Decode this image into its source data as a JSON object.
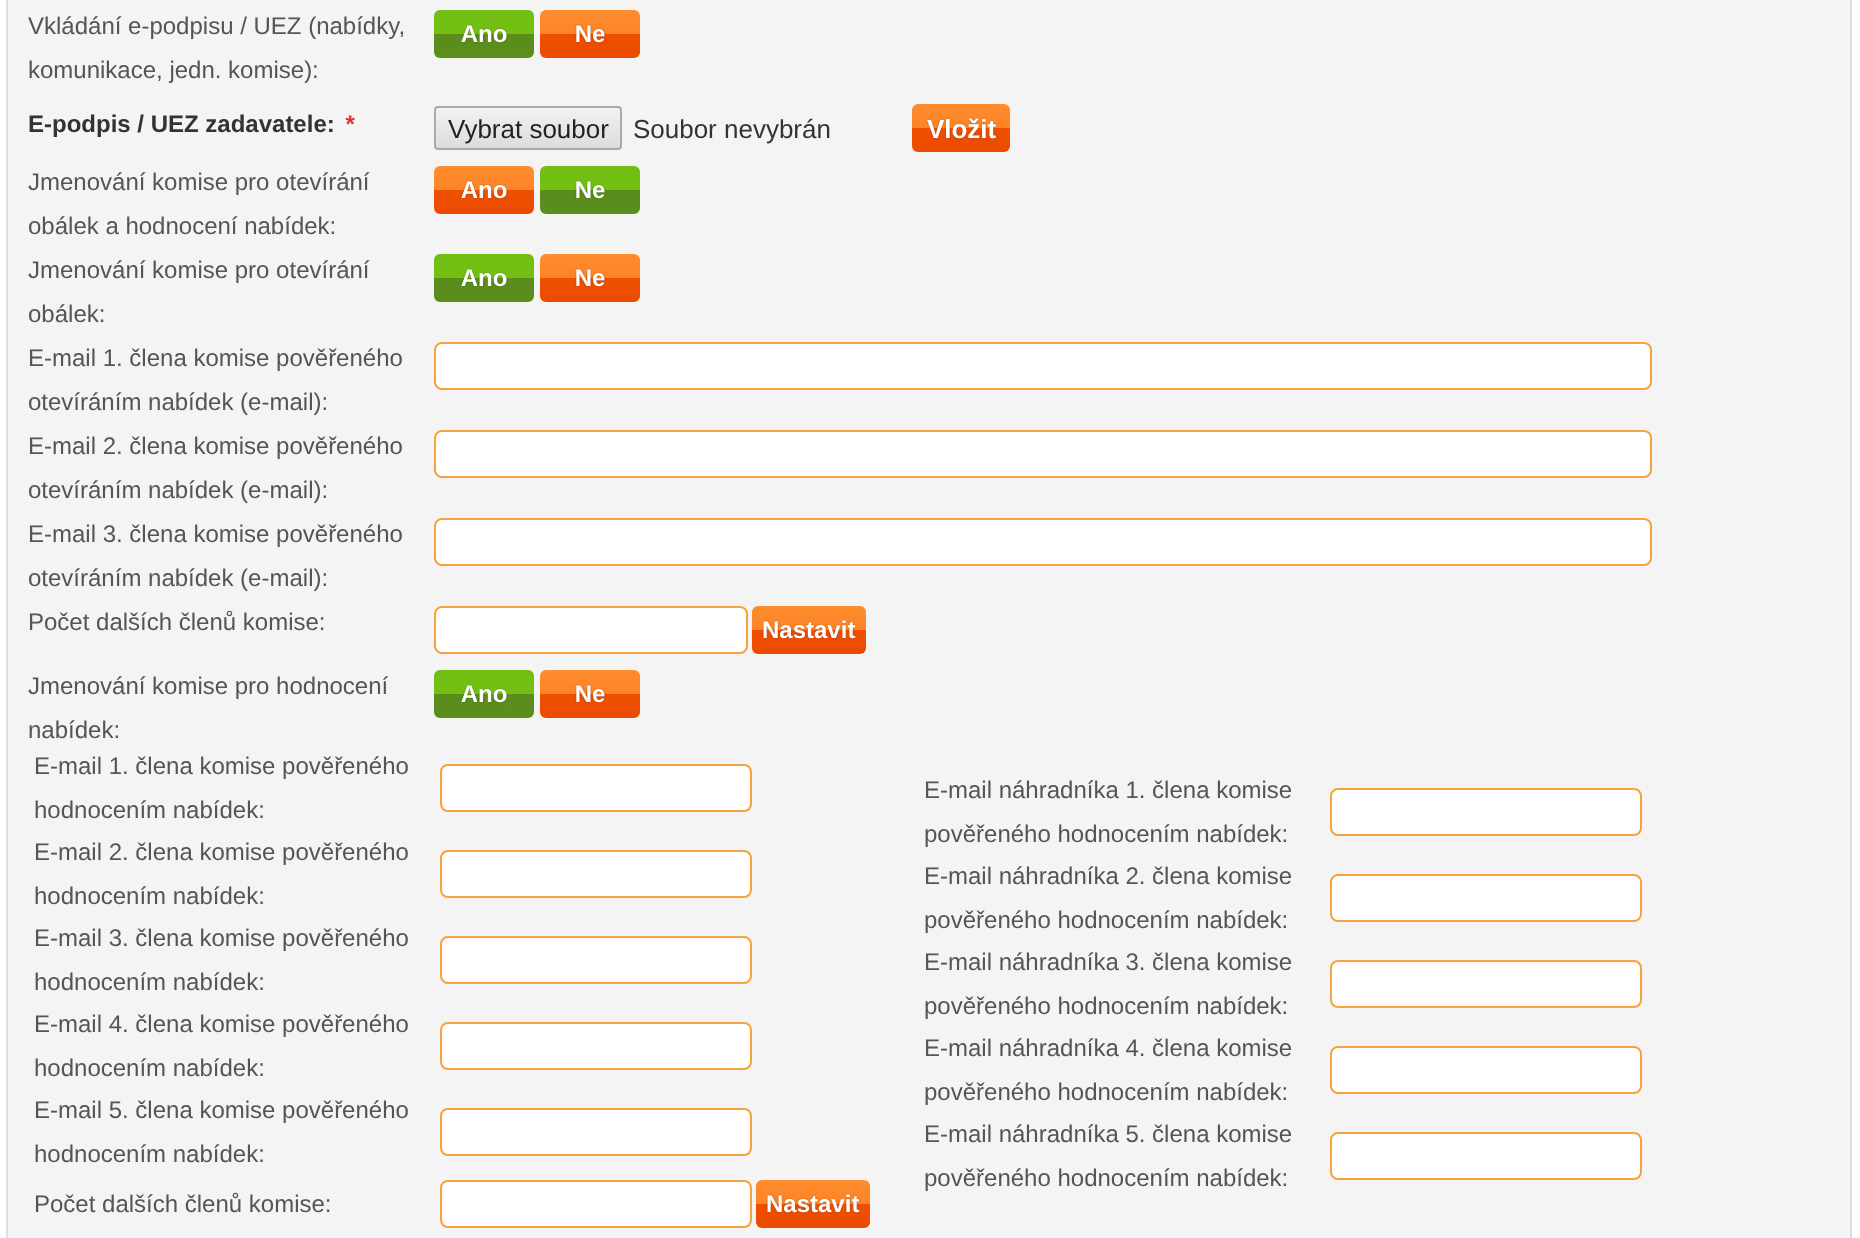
{
  "rows": [
    {
      "kind": "toggle",
      "label": "Vkládání e-podpisu / UEZ (nabídky, komunikace, jedn. komise):",
      "options": [
        {
          "label": "Ano",
          "selected": true
        },
        {
          "label": "Ne",
          "selected": false
        }
      ]
    },
    {
      "kind": "file",
      "label": "E-podpis / UEZ zadavatele:",
      "required": "*",
      "choose_button": "Vybrat soubor",
      "file_status": "Soubor nevybrán",
      "action": "Vložit"
    },
    {
      "kind": "toggle",
      "label": "Jmenování komise pro otevírání obálek a hodnocení nabídek:",
      "options": [
        {
          "label": "Ano",
          "selected": false
        },
        {
          "label": "Ne",
          "selected": true
        }
      ]
    },
    {
      "kind": "toggle",
      "label": "Jmenování komise pro otevírání obálek:",
      "options": [
        {
          "label": "Ano",
          "selected": true
        },
        {
          "label": "Ne",
          "selected": false
        }
      ]
    },
    {
      "kind": "email",
      "label": "E-mail 1. člena komise pověřeného otevíráním nabídek (e-mail):"
    },
    {
      "kind": "email",
      "label": "E-mail 2. člena komise pověřeného otevíráním nabídek (e-mail):"
    },
    {
      "kind": "email",
      "label": "E-mail 3. člena komise pověřeného otevíráním nabídek (e-mail):"
    },
    {
      "kind": "count",
      "label": "Počet dalších členů komise:",
      "action": "Nastavit"
    },
    {
      "kind": "toggle",
      "label": "Jmenování komise pro hodnocení nabídek:",
      "options": [
        {
          "label": "Ano",
          "selected": true
        },
        {
          "label": "Ne",
          "selected": false
        }
      ]
    }
  ],
  "evaluation": {
    "members": [
      {
        "label": "E-mail 1. člena komise pověřeného hodnocením nabídek:"
      },
      {
        "label": "E-mail 2. člena komise pověřeného hodnocením nabídek:"
      },
      {
        "label": "E-mail 3. člena komise pověřeného hodnocením nabídek:"
      },
      {
        "label": "E-mail 4. člena komise pověřeného hodnocením nabídek:"
      },
      {
        "label": "E-mail 5. člena komise pověřeného hodnocením nabídek:"
      }
    ],
    "count": {
      "label": "Počet dalších členů komise:",
      "action": "Nastavit"
    },
    "substitutes": [
      {
        "label": "E-mail náhradníka 1. člena komise pověřeného hodnocením nabídek:"
      },
      {
        "label": "E-mail náhradníka 2. člena komise pověřeného hodnocením nabídek:"
      },
      {
        "label": "E-mail náhradníka 3. člena komise pověřeného hodnocením nabídek:"
      },
      {
        "label": "E-mail náhradníka 4. člena komise pověřeného hodnocením nabídek:"
      },
      {
        "label": "E-mail náhradníka 5. člena komise pověřeného hodnocením nabídek:"
      }
    ]
  }
}
